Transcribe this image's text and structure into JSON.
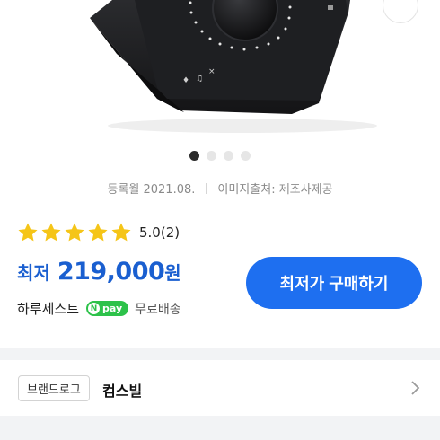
{
  "gallery": {
    "dot_count": 4,
    "active_index": 0
  },
  "meta": {
    "registered": "등록월 2021.08.",
    "image_source": "이미지출처: 제조사제공"
  },
  "rating": {
    "stars": 5,
    "score": "5.0",
    "count": "(2)",
    "star_color": "#f5c518"
  },
  "price": {
    "prefix": "최저",
    "value": "219,000",
    "unit": "원",
    "color": "#1a5fd0"
  },
  "buy_button": {
    "label": "최저가 구매하기",
    "color": "#1e6ff0"
  },
  "seller": {
    "name": "하루제스트",
    "npay_label": "pay",
    "npay_n": "N",
    "shipping": "무료배송"
  },
  "brand": {
    "badge": "브랜드로그",
    "name": "컴스빌"
  },
  "device": {
    "icons": [
      "mic-icon",
      "headphone-icon",
      "mute-icon"
    ]
  }
}
